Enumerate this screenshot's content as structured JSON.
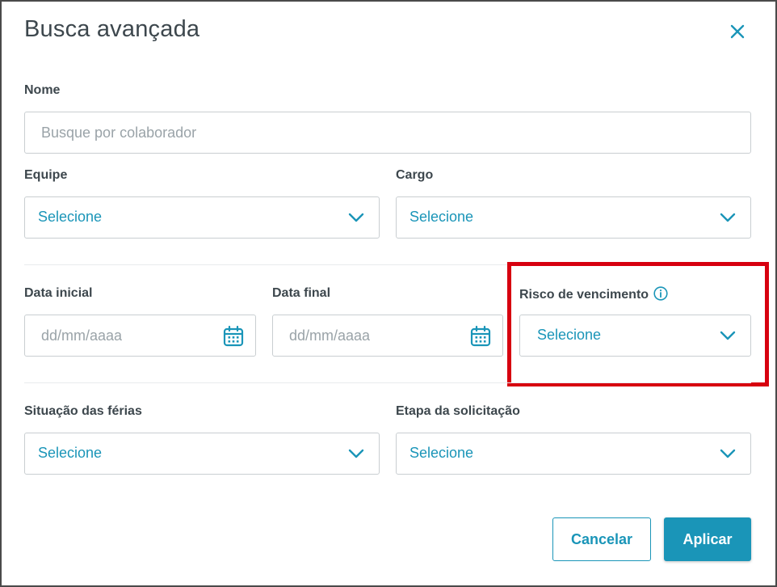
{
  "modal": {
    "title": "Busca avançada",
    "close_icon": "close-icon"
  },
  "fields": {
    "nome": {
      "label": "Nome",
      "placeholder": "Busque por colaborador",
      "value": ""
    },
    "equipe": {
      "label": "Equipe",
      "value": "Selecione"
    },
    "cargo": {
      "label": "Cargo",
      "value": "Selecione"
    },
    "data_inicial": {
      "label": "Data inicial",
      "placeholder": "dd/mm/aaaa",
      "value": ""
    },
    "data_final": {
      "label": "Data final",
      "placeholder": "dd/mm/aaaa",
      "value": ""
    },
    "risco_vencimento": {
      "label": "Risco de vencimento",
      "value": "Selecione",
      "info_icon": "info-icon"
    },
    "situacao_ferias": {
      "label": "Situação das férias",
      "value": "Selecione"
    },
    "etapa_solicitacao": {
      "label": "Etapa da solicitação",
      "value": "Selecione"
    }
  },
  "actions": {
    "cancel_label": "Cancelar",
    "apply_label": "Aplicar"
  },
  "colors": {
    "accent": "#1a95b8",
    "highlight": "#d7000f",
    "text": "#3d474d",
    "border": "#c9ced1"
  }
}
